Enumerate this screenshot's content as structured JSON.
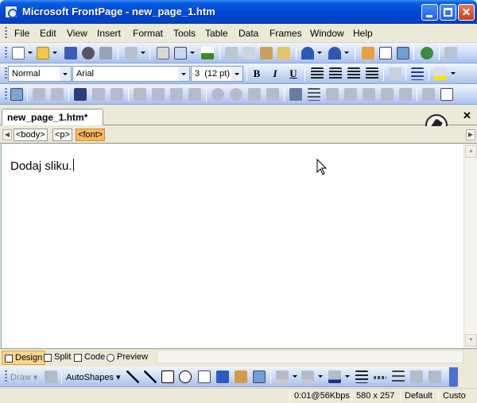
{
  "window": {
    "title": "Microsoft FrontPage - new_page_1.htm"
  },
  "menu": [
    "File",
    "Edit",
    "View",
    "Insert",
    "Format",
    "Tools",
    "Table",
    "Data",
    "Frames",
    "Window",
    "Help"
  ],
  "formatting": {
    "style": "Normal",
    "font": "Arial",
    "size": "3  (12 pt)",
    "bold": "B",
    "italic": "I",
    "underline": "U"
  },
  "document_tab": {
    "label": "new_page_1.htm*",
    "close": "✕"
  },
  "tag_selector": [
    "<body>",
    "<p>",
    "<font>"
  ],
  "editor": {
    "content": "Dodaj sliku."
  },
  "view_tabs": [
    "Design",
    "Split",
    "Code",
    "Preview"
  ],
  "drawing": {
    "draw_label": "Draw ▾",
    "autoshapes_label": "AutoShapes ▾"
  },
  "status": {
    "download_time": "0:01@56Kbps",
    "page_size": "580 x 257",
    "mode": "Default",
    "custom": "Custo"
  },
  "colors": {
    "title_bar": "#0a5fe0",
    "active_view_tab": "#fbd68c",
    "active_tag": "#f8b860"
  },
  "icons": [
    "new-page-icon",
    "open-icon",
    "save-icon",
    "search-icon",
    "print-icon",
    "spelling-icon",
    "cut-icon",
    "copy-icon",
    "paste-icon",
    "format-painter-icon",
    "undo-icon",
    "redo-icon",
    "insert-table-icon",
    "insert-picture-icon",
    "hyperlink-icon",
    "align-left-icon",
    "center-icon",
    "align-right-icon",
    "justify-icon",
    "bullets-icon",
    "highlight-icon",
    "font-color-icon"
  ]
}
